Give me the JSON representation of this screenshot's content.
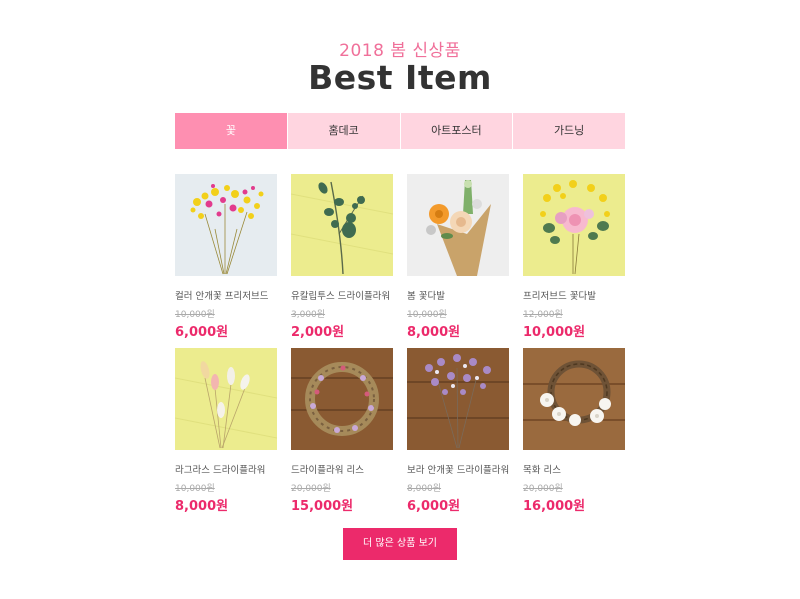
{
  "header": {
    "subtitle": "2018 봄 신상품",
    "title": "Best Item"
  },
  "tabs": [
    {
      "label": "꽃",
      "active": true
    },
    {
      "label": "홈데코",
      "active": false
    },
    {
      "label": "아트포스터",
      "active": false
    },
    {
      "label": "가드닝",
      "active": false
    }
  ],
  "products": [
    {
      "name": "컬러 안개꽃 프리저브드",
      "old_price": "10,000원",
      "price": "6,000원",
      "image": "yellow-pink-babys-breath"
    },
    {
      "name": "유칼립투스 드라이플라워",
      "old_price": "3,000원",
      "price": "2,000원",
      "image": "eucalyptus-on-yellow"
    },
    {
      "name": "봄 꽃다발",
      "old_price": "10,000원",
      "price": "8,000원",
      "image": "spring-bouquet-kraft"
    },
    {
      "name": "프리저브드 꽃다발",
      "old_price": "12,000원",
      "price": "10,000원",
      "image": "preserved-bouquet-yellow"
    },
    {
      "name": "라그라스 드라이플라워",
      "old_price": "10,000원",
      "price": "8,000원",
      "image": "lagurus-on-yellow"
    },
    {
      "name": "드라이플라워 리스",
      "old_price": "20,000원",
      "price": "15,000원",
      "image": "dried-wreath-wood"
    },
    {
      "name": "보라 안개꽃 드라이플라워",
      "old_price": "8,000원",
      "price": "6,000원",
      "image": "purple-babys-breath-wood"
    },
    {
      "name": "목화 리스",
      "old_price": "20,000원",
      "price": "16,000원",
      "image": "cotton-wreath-wood"
    }
  ],
  "more_button": {
    "label": "더 많은 상품 보기"
  },
  "colors": {
    "accent": "#ec2a6b",
    "tab_bg": "#ffd5e0",
    "tab_active": "#fe8fb1",
    "subtitle": "#f0709a"
  }
}
